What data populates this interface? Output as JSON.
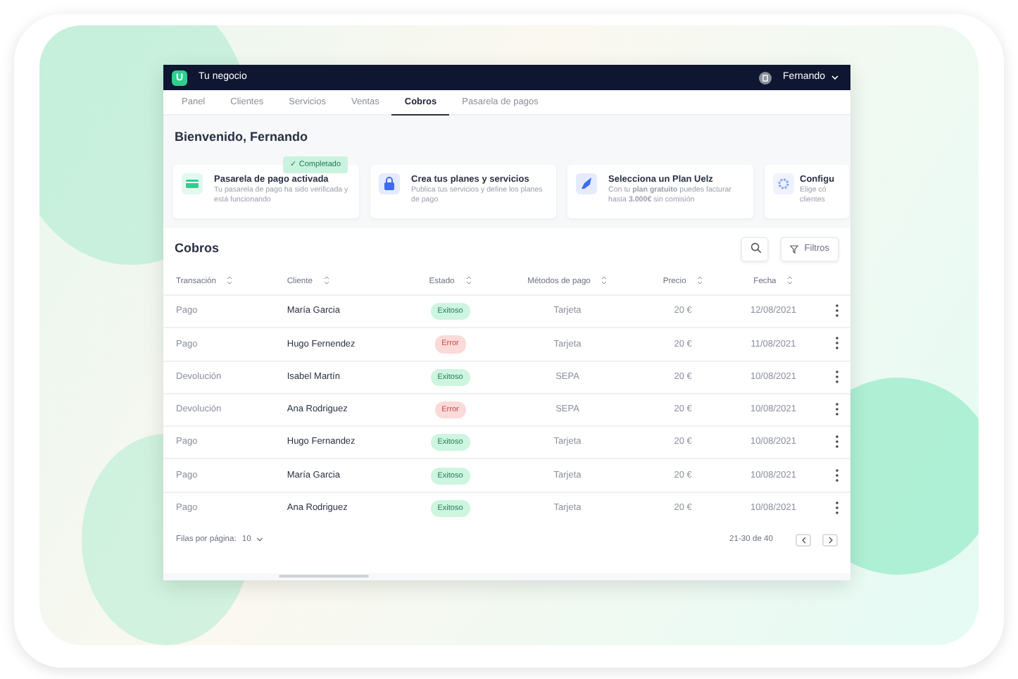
{
  "header": {
    "brand_letter": "U",
    "business": "Tu negocio",
    "user": "Fernando"
  },
  "tabs": [
    {
      "label": "Panel",
      "selected": false
    },
    {
      "label": "Clientes",
      "selected": false
    },
    {
      "label": "Servicios",
      "selected": false
    },
    {
      "label": "Ventas",
      "selected": false
    },
    {
      "label": "Cobros",
      "selected": true
    },
    {
      "label": "Pasarela de pagos",
      "selected": false
    }
  ],
  "welcome": "Bienvenido, Fernando",
  "steps": [
    {
      "kind": "card",
      "title": "Pasarela de pago activada",
      "text": "Tu pasarela de pago ha sido verificada y está funcionando",
      "badge": "✓ Completado",
      "color": "#2ecf8f"
    },
    {
      "kind": "lock",
      "title": "Crea tus planes y servicios",
      "text": "Publica tus servicios y define los planes de pago",
      "color": "#3d6cf0"
    },
    {
      "kind": "rocket",
      "title": "Selecciona un Plan Uelz",
      "text": "Con tu **plan gratuito** puedes facturar hasta **3.000€** sin comisión",
      "color": "#3d6cf0"
    },
    {
      "kind": "gear",
      "title": "Configu",
      "text": "Elige có clientes",
      "color": "#8fa8f5"
    }
  ],
  "section_title": "Cobros",
  "filter_button": "Filtros",
  "columns": [
    "Transación",
    "Cliente",
    "Estado",
    "Métodos de pago",
    "Precio",
    "Fecha"
  ],
  "rows": [
    {
      "type": "Pago",
      "client": "María Garcia",
      "status": "Exitoso",
      "color": "#cdf5e0",
      "method": "Tarjeta",
      "price": "20 €",
      "date": "12/08/2021"
    },
    {
      "type": "Pago",
      "client": "Hugo Fernendez",
      "status": "Error",
      "color": "#fbdada",
      "method": "Tarjeta",
      "price": "20 €",
      "date": "11/08/2021"
    },
    {
      "type": "Devolución",
      "client": "Isabel Martín",
      "status": "Exitoso",
      "color": "#cdf5e0",
      "method": "SEPA",
      "price": "20 €",
      "date": "10/08/2021"
    },
    {
      "type": "Devolución",
      "client": "Ana Rodriguez",
      "status": "Error",
      "color": "#fbdada",
      "method": "SEPA",
      "price": "20 €",
      "date": "10/08/2021"
    },
    {
      "type": "Pago",
      "client": "Hugo Fernandez",
      "status": "Exitoso",
      "color": "#cdf5e0",
      "method": "Tarjeta",
      "price": "20 €",
      "date": "10/08/2021"
    },
    {
      "type": "Pago",
      "client": "María Garcia",
      "status": "Exitoso",
      "color": "#cdf5e0",
      "method": "Tarjeta",
      "price": "20 €",
      "date": "10/08/2021"
    },
    {
      "type": "Pago",
      "client": "Ana Rodriguez",
      "status": "Exitoso",
      "color": "#cdf5e0",
      "method": "Tarjeta",
      "price": "20 €",
      "date": "10/08/2021"
    }
  ],
  "footer": {
    "rows_label": "Filas por página:",
    "rows_value": "10",
    "range": "21-30 de 40"
  }
}
